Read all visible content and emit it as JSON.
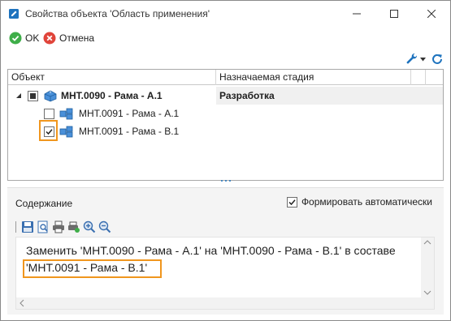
{
  "window": {
    "title": "Свойства объекта 'Область применения'"
  },
  "toolbar": {
    "ok_label": "OK",
    "cancel_label": "Отмена"
  },
  "tree": {
    "columns": [
      "Объект",
      "Назначаемая стадия"
    ],
    "rows": [
      {
        "name": "МНТ.0090 - Рама - А.1",
        "stage": "Разработка",
        "check": "indeterminate",
        "expanded": true,
        "bold": true
      },
      {
        "name": "МНТ.0091 - Рама - А.1",
        "stage": "",
        "check": "unchecked",
        "bold": false
      },
      {
        "name": "МНТ.0091 - Рама - В.1",
        "stage": "",
        "check": "checked",
        "bold": false
      }
    ]
  },
  "content": {
    "label": "Содержание",
    "auto_label": "Формировать автоматически",
    "auto_checked": true,
    "text_line1": "Заменить 'МНТ.0090 - Рама - А.1' на 'МНТ.0090 - Рама - В.1' в составе",
    "text_line2": "'МНТ.0091 - Рама - В.1'"
  },
  "icons": {
    "app": "edit-pencil-icon",
    "ok": "ok-check-icon",
    "cancel": "cancel-x-icon",
    "settings": "wrench-icon",
    "refresh": "refresh-icon"
  },
  "colors": {
    "highlight": "#f0961e",
    "ok_green": "#3fae49",
    "cancel_red": "#e0443a",
    "accent_blue": "#1e73be"
  }
}
